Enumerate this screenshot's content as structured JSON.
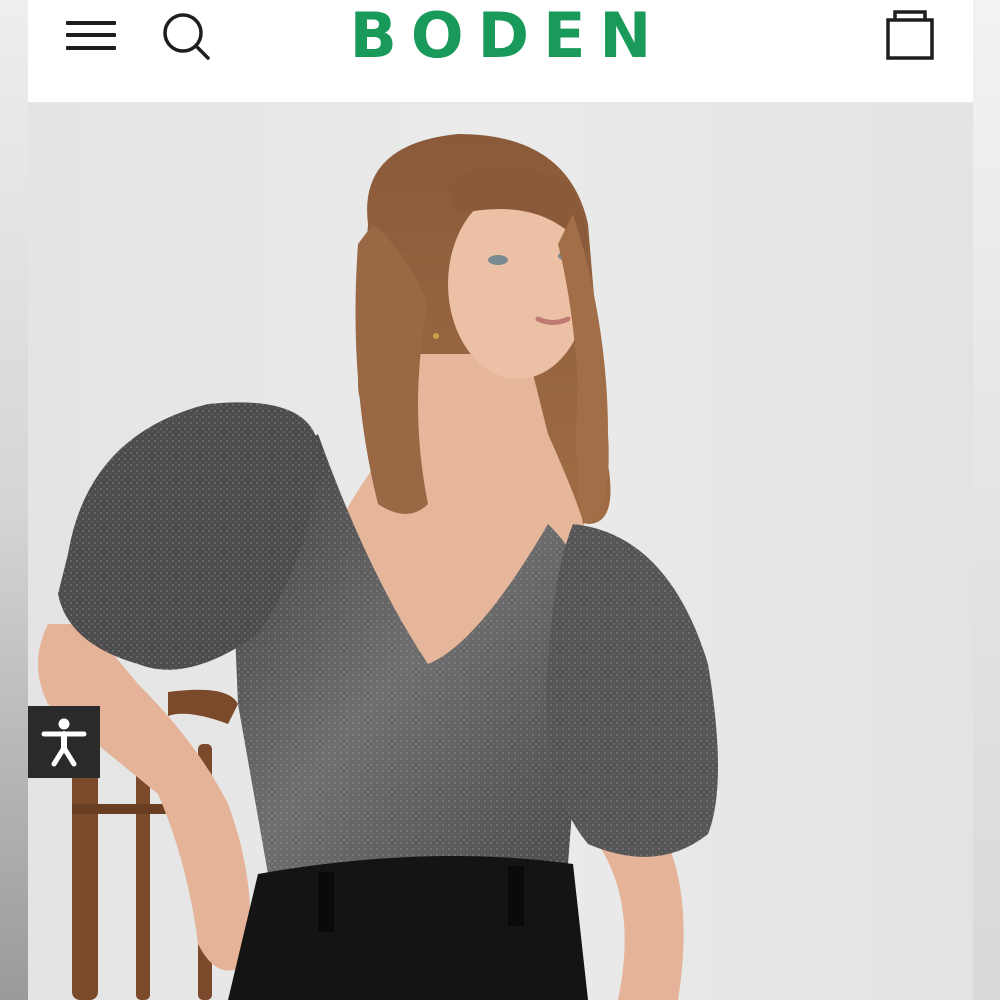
{
  "header": {
    "logo": "BODEN",
    "menu_icon": "hamburger-menu-icon",
    "search_icon": "search-icon",
    "bag_icon": "shopping-bag-icon"
  },
  "hero": {
    "image": "model-wearing-metallic-puff-sleeve-top-photo"
  },
  "accessibility": {
    "icon": "accessibility-person-icon"
  },
  "colors": {
    "brand": "#1a9a5a",
    "icon": "#1e1e1e",
    "accessibility_bg": "#2a2a2a"
  }
}
